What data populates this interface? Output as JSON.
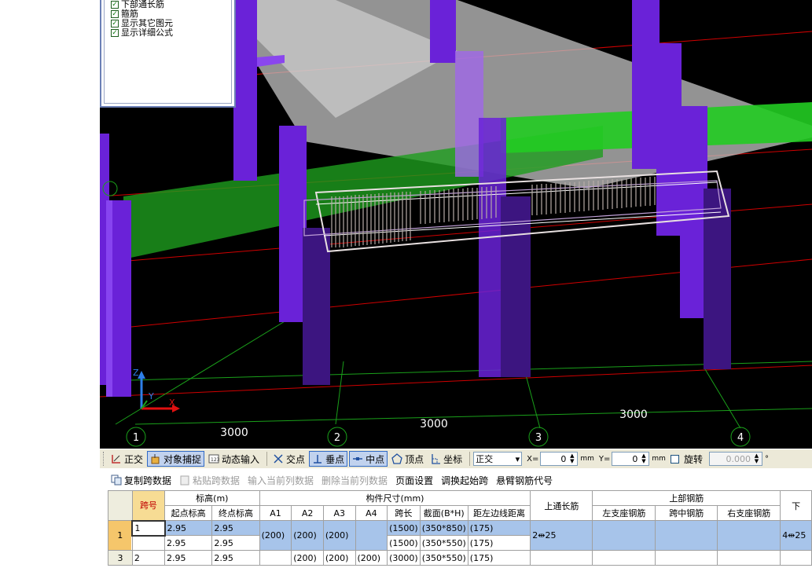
{
  "layer_panel": {
    "items": [
      {
        "label": "下部通长筋",
        "checked": true
      },
      {
        "label": "箍筋",
        "checked": true
      },
      {
        "label": "显示其它图元",
        "checked": true
      },
      {
        "label": "显示详细公式",
        "checked": true
      }
    ]
  },
  "viewport": {
    "axis_labels": [
      "1",
      "2",
      "3",
      "4"
    ],
    "span_dims": [
      "3000",
      "3000",
      "3000"
    ],
    "axes": {
      "z": "Z",
      "y": "Y",
      "x": "X"
    }
  },
  "snapbar": {
    "ortho": "正交",
    "object_snap": "对象捕捉",
    "dynamic_input": "动态输入",
    "intersection": "交点",
    "perpendicular": "垂点",
    "midpoint": "中点",
    "vertex": "顶点",
    "coordinate": "坐标",
    "mode_select": "正交",
    "x_label": "X=",
    "x_value": "0",
    "x_unit": "mm",
    "y_label": "Y=",
    "y_value": "0",
    "y_unit": "mm",
    "rotate_label": "旋转",
    "rotate_value": "0.000",
    "rotate_unit": "°"
  },
  "toolbar2": {
    "copy_span": "复制跨数据",
    "paste_span": "粘贴跨数据",
    "input_col": "输入当前列数据",
    "delete_col": "删除当前列数据",
    "page_setup": "页面设置",
    "swap_start": "调换起始跨",
    "cantilever": "悬臂钢筋代号"
  },
  "grid": {
    "headers": {
      "span_no": "跨号",
      "elevation": "标高(m)",
      "start_elev": "起点标高",
      "end_elev": "终点标高",
      "dims": "构件尺寸(mm)",
      "a1": "A1",
      "a2": "A2",
      "a3": "A3",
      "a4": "A4",
      "span_len": "跨长",
      "section": "截面(B*H)",
      "dist_left": "距左边线距离",
      "top_through": "上通长筋",
      "top_rebar": "上部钢筋",
      "left_support": "左支座钢筋",
      "mid_span": "跨中钢筋",
      "right_support": "右支座钢筋",
      "bottom": "下"
    },
    "rows": [
      {
        "row": "1",
        "span": "1",
        "start": "2.95",
        "end": "2.95",
        "a1": "(200)",
        "a2": "(200)",
        "a3": "(200)",
        "a4": "",
        "len": "(1500)",
        "sec": "(350*850)",
        "dist": "(175)",
        "top": "2⇹25",
        "left": "",
        "mid": "",
        "right": "",
        "bot": "4⇹25"
      },
      {
        "row": "",
        "span": "",
        "start": "2.95",
        "end": "2.95",
        "a1": "",
        "a2": "",
        "a3": "",
        "a4": "",
        "len": "(1500)",
        "sec": "(350*550)",
        "dist": "(175)",
        "top": "",
        "left": "",
        "mid": "",
        "right": "",
        "bot": ""
      },
      {
        "row": "3",
        "span": "2",
        "start": "2.95",
        "end": "2.95",
        "a1": "",
        "a2": "(200)",
        "a3": "(200)",
        "a4": "(200)",
        "len": "(3000)",
        "sec": "(350*550)",
        "dist": "(175)",
        "top": "",
        "left": "",
        "mid": "",
        "right": "",
        "bot": ""
      }
    ]
  }
}
